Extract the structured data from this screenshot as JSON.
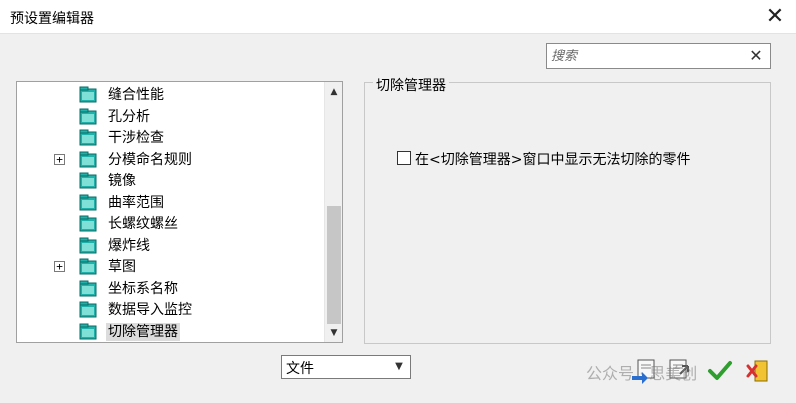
{
  "window": {
    "title": "预设置编辑器"
  },
  "search": {
    "placeholder": "搜索"
  },
  "tree": {
    "items": [
      {
        "label": "缝合性能",
        "expandable": false
      },
      {
        "label": "孔分析",
        "expandable": false
      },
      {
        "label": "干涉检查",
        "expandable": false
      },
      {
        "label": "分模命名规则",
        "expandable": true
      },
      {
        "label": "镜像",
        "expandable": false
      },
      {
        "label": "曲率范围",
        "expandable": false
      },
      {
        "label": "长螺纹螺丝",
        "expandable": false
      },
      {
        "label": "爆炸线",
        "expandable": false
      },
      {
        "label": "草图",
        "expandable": true
      },
      {
        "label": "坐标系名称",
        "expandable": false
      },
      {
        "label": "数据导入监控",
        "expandable": false
      },
      {
        "label": "切除管理器",
        "expandable": false,
        "selected": true
      }
    ]
  },
  "settings": {
    "group_title": "切除管理器",
    "option_label": "在<切除管理器>窗口中显示无法切除的零件",
    "option_checked": false
  },
  "footer": {
    "scope_value": "文件",
    "watermark": "公众号 · 思美创"
  },
  "colors": {
    "icon_teal": "#20b2aa",
    "selection_bg": "#dcdcdc",
    "accept_green": "#2e9e2e"
  }
}
